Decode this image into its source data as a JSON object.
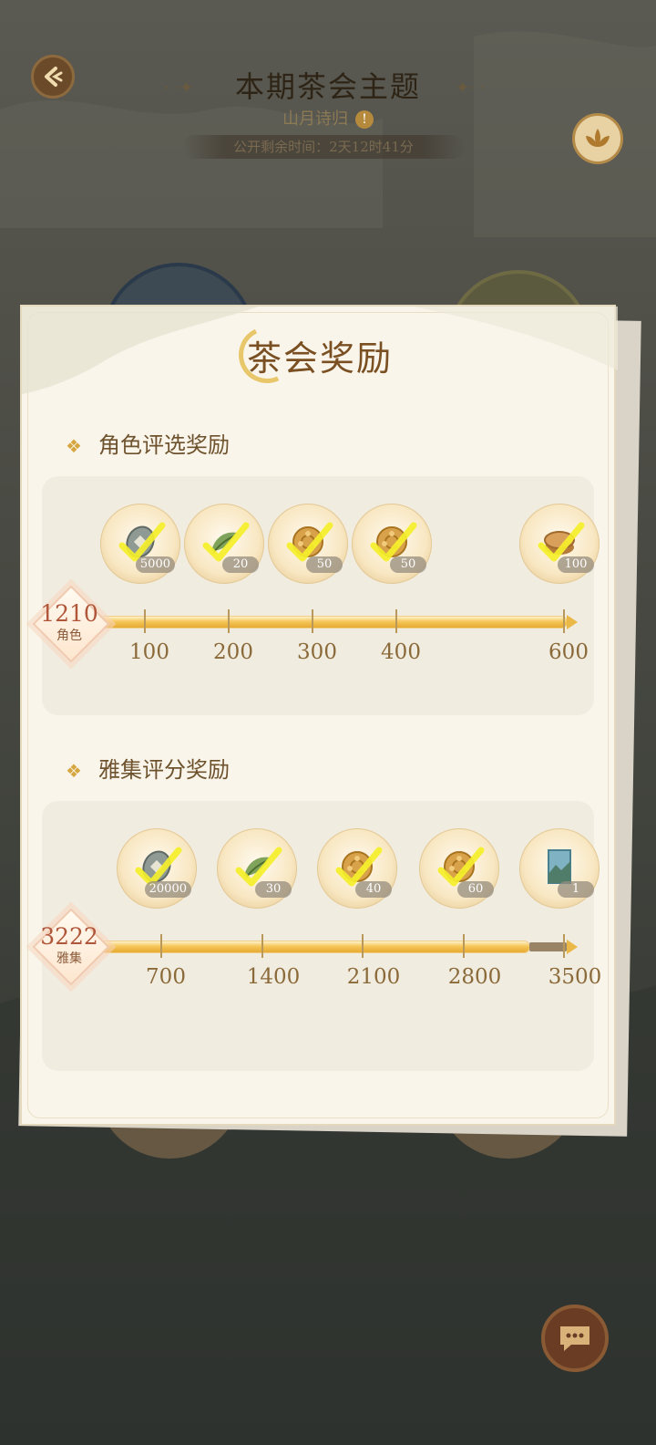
{
  "header": {
    "title": "本期茶会主题",
    "subtitle": "山月诗归",
    "info_icon": "!",
    "timer": "公开剩余时间：2天12时41分"
  },
  "modal": {
    "title": "茶会奖励",
    "sections": [
      {
        "title": "角色评选奖励",
        "score": "1210",
        "score_label": "角色",
        "progress": 1.0,
        "milestones": [
          {
            "value": "100",
            "reward": "coin",
            "count": "5000",
            "claimed": true
          },
          {
            "value": "200",
            "reward": "tea-leaf",
            "count": "20",
            "claimed": true
          },
          {
            "value": "300",
            "reward": "mooncake",
            "count": "50",
            "claimed": true
          },
          {
            "value": "400",
            "reward": "mooncake",
            "count": "50",
            "claimed": true
          },
          {
            "value": "600",
            "reward": "cake",
            "count": "100",
            "claimed": true
          }
        ]
      },
      {
        "title": "雅集评分奖励",
        "score": "3222",
        "score_label": "雅集",
        "progress": 0.92,
        "milestones": [
          {
            "value": "700",
            "reward": "coin",
            "count": "20000",
            "claimed": true
          },
          {
            "value": "1400",
            "reward": "tea-leaf",
            "count": "30",
            "claimed": true
          },
          {
            "value": "2100",
            "reward": "mooncake",
            "count": "40",
            "claimed": true
          },
          {
            "value": "2800",
            "reward": "mooncake",
            "count": "60",
            "claimed": true
          },
          {
            "value": "3500",
            "reward": "scenery-card",
            "count": "1",
            "claimed": false
          }
        ]
      }
    ]
  },
  "colors": {
    "accent": "#7a4f22",
    "progress": "#f5c657",
    "check": "#f5ef2a",
    "score": "#b0563a"
  }
}
